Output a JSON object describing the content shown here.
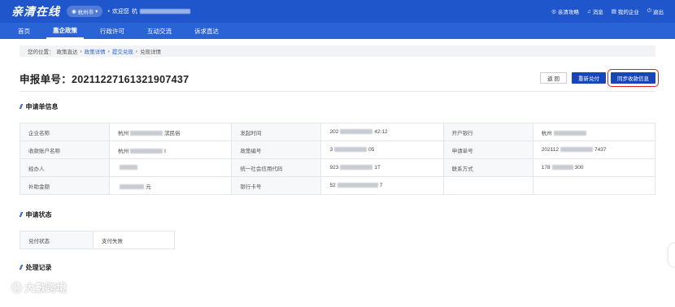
{
  "header": {
    "logo": "亲清在线",
    "city": "杭州市",
    "welcome": "欢迎您",
    "welcome_name_partial": "杭",
    "links": {
      "help": "亲清攻略",
      "message": "消息",
      "my_company": "我的企业",
      "logout": "退出"
    }
  },
  "nav": {
    "items": [
      "首页",
      "惠企政策",
      "行政许可",
      "互动交流",
      "诉求直达"
    ],
    "active_index": 1
  },
  "breadcrumb": {
    "prefix": "您的位置：",
    "items": [
      "政策直达",
      "政策详情",
      "提交兑现",
      "兑现详情"
    ]
  },
  "page": {
    "title": "申报单号：20211227161321907437"
  },
  "actions": {
    "back": "返 回",
    "resubmit": "重新兑付",
    "sync": "同步收款信息"
  },
  "sections": {
    "apply_info": "申请单信息",
    "apply_status": "申请状态",
    "process_record": "处理记录"
  },
  "apply_info": {
    "rows": [
      [
        {
          "label": "企业名称",
          "value_pre": "杭州",
          "value_post": "滨民俗"
        },
        {
          "label": "发起时间",
          "value_pre": "202",
          "value_post": "42:12"
        },
        {
          "label": "开户银行",
          "value_pre": "杭州",
          "value_post": ""
        }
      ],
      [
        {
          "label": "收款账户名称",
          "value_pre": "杭州",
          "value_post": "t"
        },
        {
          "label": "政策编号",
          "value_pre": "3",
          "value_post": "05"
        },
        {
          "label": "申请单号",
          "value_pre": "202112",
          "value_post": "7437"
        }
      ],
      [
        {
          "label": "经办人",
          "value_pre": "",
          "value_post": ""
        },
        {
          "label": "统一社会信用代码",
          "value_pre": "923",
          "value_post": "1T"
        },
        {
          "label": "联系方式",
          "value_pre": "178",
          "value_post": "300"
        }
      ],
      [
        {
          "label": "补助金额",
          "value_pre": "",
          "value_post": "元"
        },
        {
          "label": "银行卡号",
          "value_pre": "52",
          "value_post": "7"
        },
        {
          "label": "",
          "value_pre": "",
          "value_post": ""
        }
      ]
    ]
  },
  "apply_status": {
    "label": "兑付状态",
    "value": "支付失败"
  },
  "watermark": "大數跨境",
  "colors": {
    "header_bg": "#1f56cc",
    "nav_bg": "#2a63d6",
    "primary_btn": "#1746b8",
    "highlight_box": "#e02020"
  }
}
